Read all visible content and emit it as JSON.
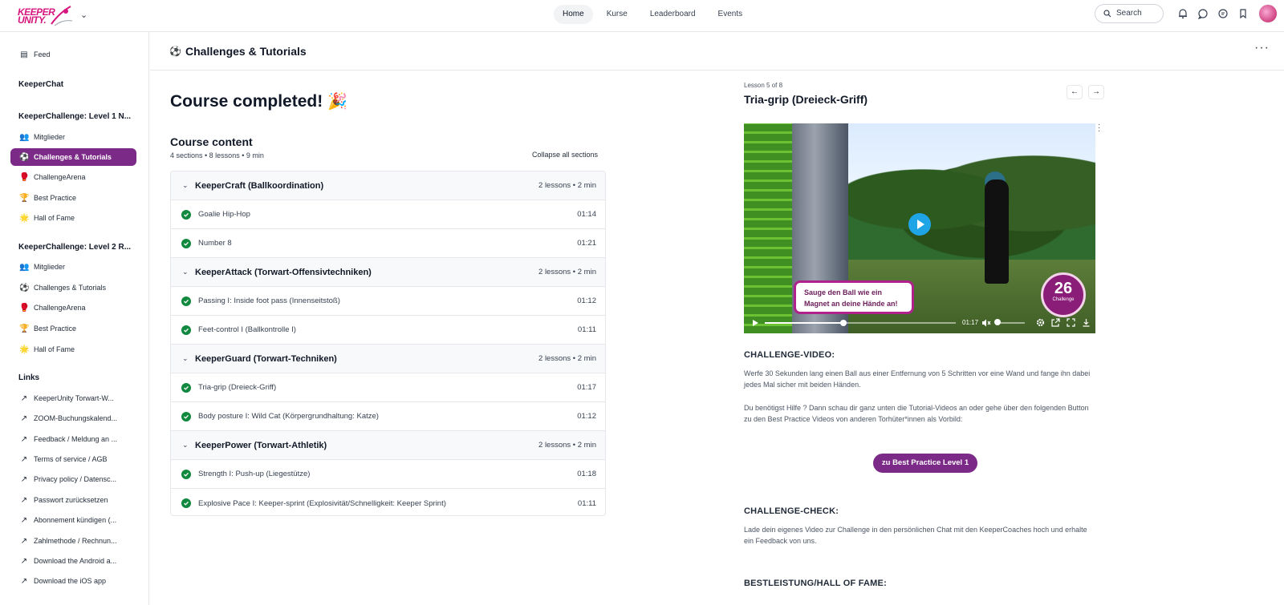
{
  "topnav": {
    "logo": "KEEPER UNITY.",
    "links": [
      "Home",
      "Kurse",
      "Leaderboard",
      "Events"
    ],
    "search_placeholder": "Search"
  },
  "sidebar": {
    "feed": "Feed",
    "keeperchat": "KeeperChat",
    "group1_title": "KeeperChallenge: Level 1 N...",
    "group1_items": [
      "Mitglieder",
      "Challenges & Tutorials",
      "ChallengeArena",
      "Best Practice",
      "Hall of Fame"
    ],
    "group2_title": "KeeperChallenge: Level 2 R...",
    "group2_items": [
      "Mitglieder",
      "Challenges & Tutorials",
      "ChallengeArena",
      "Best Practice",
      "Hall of Fame"
    ],
    "links_title": "Links",
    "links": [
      "KeeperUnity Torwart-W...",
      "ZOOM-Buchungskalend...",
      "Feedback / Meldung an ...",
      "Terms of service / AGB",
      "Privacy policy / Datensc...",
      "Passwort zurücksetzen",
      "Abonnement kündigen (...",
      "Zahlmethode / Rechnun...",
      "Download the Android a...",
      "Download the iOS app"
    ]
  },
  "page": {
    "title": "Challenges & Tutorials",
    "completed": "Course completed!"
  },
  "course": {
    "title": "Course content",
    "meta": "4 sections • 8 lessons • 9 min",
    "collapse": "Collapse all sections",
    "sections": [
      {
        "title": "KeeperCraft (Ballkoordination)",
        "meta": "2 lessons • 2 min",
        "lessons": [
          {
            "title": "Goalie Hip-Hop",
            "time": "01:14"
          },
          {
            "title": "Number 8",
            "time": "01:21"
          }
        ]
      },
      {
        "title": "KeeperAttack (Torwart-Offensivtechniken)",
        "meta": "2 lessons • 2 min",
        "lessons": [
          {
            "title": "Passing I: Inside foot pass (Innenseitstoß)",
            "time": "01:12"
          },
          {
            "title": "Feet-control I (Ballkontrolle I)",
            "time": "01:11"
          }
        ]
      },
      {
        "title": "KeeperGuard (Torwart-Techniken)",
        "meta": "2 lessons • 2 min",
        "lessons": [
          {
            "title": "Tria-grip (Dreieck-Griff)",
            "time": "01:17"
          },
          {
            "title": "Body posture I: Wild Cat (Körpergrundhaltung: Katze)",
            "time": "01:12"
          }
        ]
      },
      {
        "title": "KeeperPower (Torwart-Athletik)",
        "meta": "2 lessons • 2 min",
        "lessons": [
          {
            "title": "Strength I: Push-up (Liegestütze)",
            "time": "01:18"
          },
          {
            "title": "Explosive Pace I: Keeper-sprint (Explosivität/Schnelligkeit: Keeper Sprint)",
            "time": "01:11"
          }
        ]
      }
    ]
  },
  "lesson": {
    "of": "Lesson 5 of 8",
    "title": "Tria-grip (Dreieck-Griff)",
    "video": {
      "bubble": "Sauge den Ball wie ein Magnet an deine Hände an!",
      "badge_number": "26",
      "badge_label": "Challenge",
      "time": "01:17",
      "progress": 0.41,
      "volume": 0.0
    },
    "h1": "CHALLENGE-VIDEO:",
    "p1": "Werfe 30 Sekunden lang einen Ball aus einer Entfernung von 5 Schritten vor eine Wand und fange ihn dabei jedes Mal sicher mit beiden Händen.",
    "p2": "Du benötigst Hilfe ? Dann schau dir ganz unten die Tutorial-Videos an oder gehe über den folgenden Button zu den Best Practice Videos von anderen Torhüter*innen als Vorbild:",
    "cta": "zu Best Practice Level 1",
    "h2": "CHALLENGE-CHECK:",
    "p3": "Lade dein eigenes Video zur Challenge in den persönlichen Chat mit den KeeperCoaches hoch und erhalte ein Feedback von uns.",
    "h3": "BESTLEISTUNG/HALL OF FAME:"
  },
  "colors": {
    "accent": "#7b2a87",
    "check": "#10893e",
    "brand": "#d6157e"
  }
}
